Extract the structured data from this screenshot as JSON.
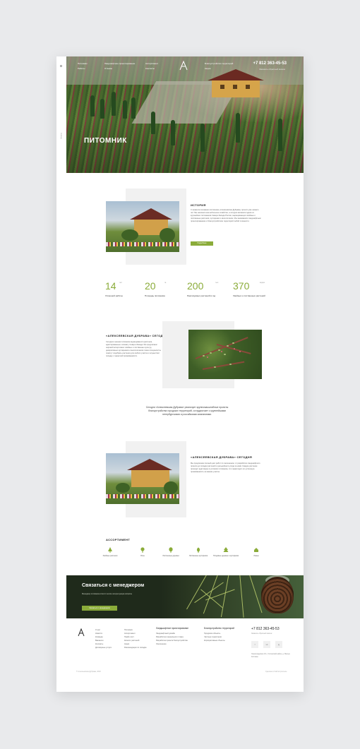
{
  "hero": {
    "title": "ПИТОМНИК",
    "phone": "+7 812 363-45-53",
    "phone_sub": "Заказать обратный звонок",
    "side_label": "Назад",
    "nav": [
      "Питомник",
      "Ландшафтное проектирование",
      "Ассортимент",
      "Благоустройство территорий",
      "Работы",
      "Отзывы",
      "Контакты",
      "Акции"
    ]
  },
  "history": {
    "title": "ИСТОРИЯ",
    "text": "С момента основания питомника «Алексеевская Дубрава» прошло уже немало лет. Мы начинали как небольшое хозяйство, а сегодня являемся одним из крупнейших питомников Северо-Запада России, выращивающих хвойные и лиственные растения, кустарники и многолетники. Мы занимаемся ландшафтным проектированием и благоустройством территорий любой сложности.",
    "button": "Подробнее"
  },
  "stats": [
    {
      "num": "14",
      "unit": "лет",
      "label": "Успешной работы"
    },
    {
      "num": "20",
      "unit": "га",
      "label": "Площадь питомника"
    },
    {
      "num": "200",
      "unit": "тыс.",
      "label": "Реализуемых растений в год"
    },
    {
      "num": "370",
      "unit": "видов",
      "label": "Хвойных и лиственных растений"
    }
  ],
  "today": {
    "title": "«АЛЕКСЕЕВСКАЯ ДУБРАВА» СЕГОДНЯ",
    "text": "Сегодня в нашем питомнике выращиваются растения, адаптированные к климату Северо-Запада. Мы предлагаем широкий ассортимент хвойных и лиственных культур, декоративных кустарников и многолетников. Наши специалисты помогут подобрать растения для любого участка и осуществят посадку с гарантией приживаемости."
  },
  "center_text": "Сегодня «Алексеевская Дубрава» реализует крупномасштабные проекты благоустройства городских территорий, сотрудничает с крупнейшими петербургскими и российскими компаниями.",
  "today2": {
    "title": "«АЛЕКСЕЕВСКАЯ ДУБРАВА» СЕГОДНЯ",
    "text": "Мы предлагаем полный цикл работ по озеленению: от разработки ландшафтного проекта до посадки растений и дальнейшего ухода за ними. Каждое растение проходит адаптацию в условиях питомника, что гарантирует его успешную приживаемость на вашем участке."
  },
  "assortment": {
    "title": "АССОРТИМЕНТ",
    "items": [
      "Хвойные растения",
      "Розы",
      "Лиственные деревья",
      "Лиственные кустарники",
      "Плодовые деревья и кустарники",
      "Лианы"
    ]
  },
  "contact": {
    "title": "Связаться с менеджером",
    "text": "Менеджер питомника ответит на все интересующие вопросы",
    "button": "Связаться с менеджером"
  },
  "footer": {
    "col1": [
      "О нас",
      "Новости",
      "Команда",
      "Вакансии",
      "Контакты",
      "Договорные услуги"
    ],
    "col2": [
      "Питомник",
      "Ассортимент",
      "Прайс-лист",
      "Каталог растений",
      "Акции",
      "Рекомендации по посадке"
    ],
    "col3_title": "Ландшафтное проектирование",
    "col3": [
      "Ландшафтный дизайн",
      "Разработка генерального плана",
      "Разработка проекта благоустройства",
      "Озеленение"
    ],
    "col4_title": "Благоустройство территорий",
    "col4": [
      "Городские объекты",
      "Частные территории",
      "Корпоративные объекты"
    ],
    "phone": "+7 812 363-45-53",
    "phone_sub": "Заказать обратный звонок",
    "socials": [
      "f",
      "vk",
      "ig"
    ],
    "address": "Ленинградская обл., Гатчинский район, д. Малые Колпаны",
    "copyright": "© Алексеевская Дубрава, 2018",
    "developer": "Сделано в Сайтостроителе"
  },
  "colors": {
    "accent": "#8bac3a"
  }
}
